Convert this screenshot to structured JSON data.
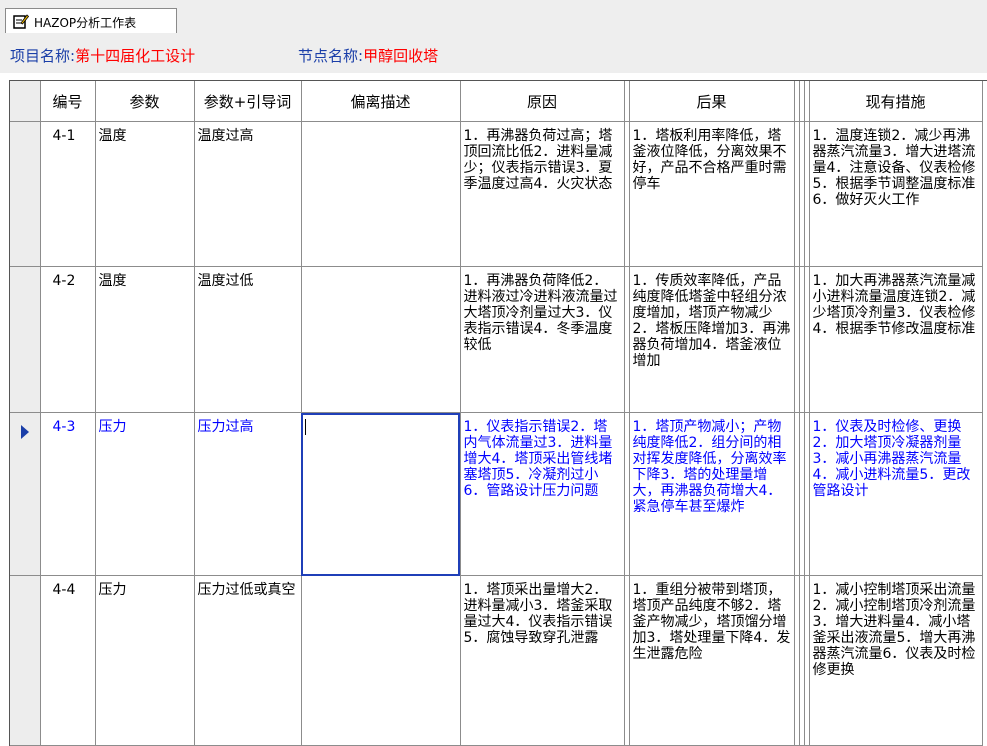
{
  "tab": {
    "label": "HAZOP分析工作表",
    "icon": "edit-form-icon"
  },
  "project": {
    "label": "项目名称:",
    "value": "第十四届化工设计"
  },
  "node": {
    "label": "节点名称:",
    "value": "甲醇回收塔"
  },
  "colors": {
    "label_blue": "#1a3ea8",
    "value_red": "#ff0000",
    "current_row_text": "#0000ff"
  },
  "columns": {
    "id": "编号",
    "param": "参数",
    "param_guide": "参数+引导词",
    "deviation": "偏离描述",
    "cause": "原因",
    "consequence": "后果",
    "measures": "现有措施"
  },
  "rows": [
    {
      "id": "4-1",
      "param": "温度",
      "param_guide": "温度过高",
      "deviation": "",
      "cause": "1．再沸器负荷过高；塔顶回流比低2．进料量减少；仪表指示错误3．夏季温度过高4．火灾状态",
      "consequence": "1．塔板利用率降低，塔釜液位降低，分离效果不好，产品不合格严重时需停车",
      "measures": "1．温度连锁2．减少再沸器蒸汽流量3．增大进塔流量4．注意设备、仪表检修5．根据季节调整温度标准6．做好灭火工作"
    },
    {
      "id": "4-2",
      "param": "温度",
      "param_guide": "温度过低",
      "deviation": "",
      "cause": "1．再沸器负荷降低2．进料液过冷进料液流量过大塔顶冷剂量过大3．仪表指示错误4．冬季温度较低",
      "consequence": "1．传质效率降低，产品纯度降低塔釜中轻组分浓度增加，塔顶产物减少2．塔板压降增加3．再沸器负荷增加4．塔釜液位增加",
      "measures": "1．加大再沸器蒸汽流量减小进料流量温度连锁2．减少塔顶冷剂量3．仪表检修4．根据季节修改温度标准"
    },
    {
      "id": "4-3",
      "param": "压力",
      "param_guide": "压力过高",
      "deviation": "",
      "cause": "1．仪表指示错误2．塔内气体流量过3．进料量增大4．塔顶采出管线堵塞塔顶5．冷凝剂过小6．管路设计压力问题",
      "consequence": "1．塔顶产物减小；产物纯度降低2．组分间的相对挥发度降低，分离效率下降3．塔的处理量增大，再沸器负荷增大4．紧急停车甚至爆炸",
      "measures": "1．仪表及时检修、更换2．加大塔顶冷凝器剂量3．减小再沸器蒸汽流量4．减小进料流量5．更改管路设计"
    },
    {
      "id": "4-4",
      "param": "压力",
      "param_guide": "压力过低或真空",
      "deviation": "",
      "cause": "1．塔顶采出量增大2．进料量减小3．塔釜采取量过大4．仪表指示错误5．腐蚀导致穿孔泄露",
      "consequence": "1．重组分被带到塔顶，塔顶产品纯度不够2．塔釜产物减少，塔顶馏分增加3．塔处理量下降4．发生泄露危险",
      "measures": "1．减小控制塔顶采出流量2．减小控制塔顶冷剂流量3．增大进料量4．减小塔釜采出液流量5．增大再沸器蒸汽流量6．仪表及时检修更换"
    }
  ]
}
